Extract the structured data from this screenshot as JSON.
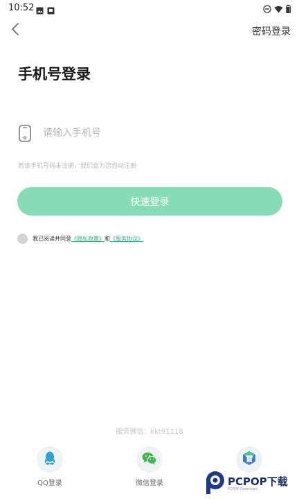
{
  "status_bar": {
    "time": "10:52",
    "left_icons": [
      "image-icon",
      "notification-box-icon"
    ],
    "right_icons": [
      "do-not-disturb-icon",
      "wifi-icon",
      "battery-icon"
    ]
  },
  "header": {
    "back_icon": "chevron-left-icon",
    "password_login_label": "密码登录"
  },
  "title": "手机号登录",
  "phone_input": {
    "icon": "phone-icon",
    "value": "",
    "placeholder": "请输入手机号"
  },
  "hint": "若该手机号码未注册，我们会为您自动注册",
  "quick_login_button": {
    "label": "快速登录",
    "color": "#86dcb4"
  },
  "agreement": {
    "checked": false,
    "prefix": "我已阅读并同意",
    "privacy_link": "《隐私政策》",
    "and": "和",
    "service_link": "《服务协议》",
    "link_color": "#3ba77e"
  },
  "footer": {
    "service_wechat": "服务微信：kkt91118",
    "social_logins": [
      {
        "label": "QQ登录",
        "icon": "qq-icon"
      },
      {
        "label": "微信登录",
        "icon": "wechat-icon"
      },
      {
        "label": "",
        "icon": "app-logo-icon"
      }
    ]
  },
  "watermark": {
    "main": "PCPOP下载",
    "sub": "PCPOP Download"
  }
}
